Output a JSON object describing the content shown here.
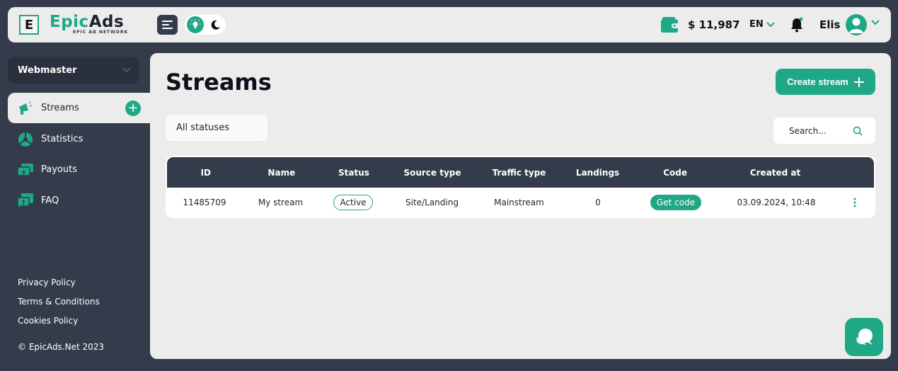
{
  "header": {
    "logo_letter": "E",
    "brand_part1": "Epic",
    "brand_part2": "Ads",
    "brand_tagline": "EPIC AD NETWORK",
    "balance": "$ 11,987",
    "language": "EN",
    "username": "Elis"
  },
  "sidebar": {
    "role": "Webmaster",
    "items": [
      {
        "label": "Streams",
        "icon": "megaphone-icon",
        "active": true
      },
      {
        "label": "Statistics",
        "icon": "pie-chart-icon",
        "active": false
      },
      {
        "label": "Payouts",
        "icon": "money-icon",
        "active": false
      },
      {
        "label": "FAQ",
        "icon": "question-chat-icon",
        "active": false
      }
    ],
    "footer_links": [
      "Privacy Policy",
      "Terms & Conditions",
      "Cookies Policy"
    ],
    "copyright": "© EpicAds.Net 2023"
  },
  "main": {
    "title": "Streams",
    "create_button": "Create stream",
    "status_filter": "All statuses",
    "search_placeholder": "Search...",
    "table": {
      "columns": [
        "ID",
        "Name",
        "Status",
        "Source type",
        "Traffic type",
        "Landings",
        "Code",
        "Created at"
      ],
      "rows": [
        {
          "id": "11485709",
          "name": "My stream",
          "status": "Active",
          "source_type": "Site/Landing",
          "traffic_type": "Mainstream",
          "landings": "0",
          "code": "Get code",
          "created_at": "03.09.2024, 10:48"
        }
      ]
    }
  },
  "colors": {
    "accent": "#1fa886",
    "dark": "#343b4b",
    "panel": "#ececec"
  }
}
